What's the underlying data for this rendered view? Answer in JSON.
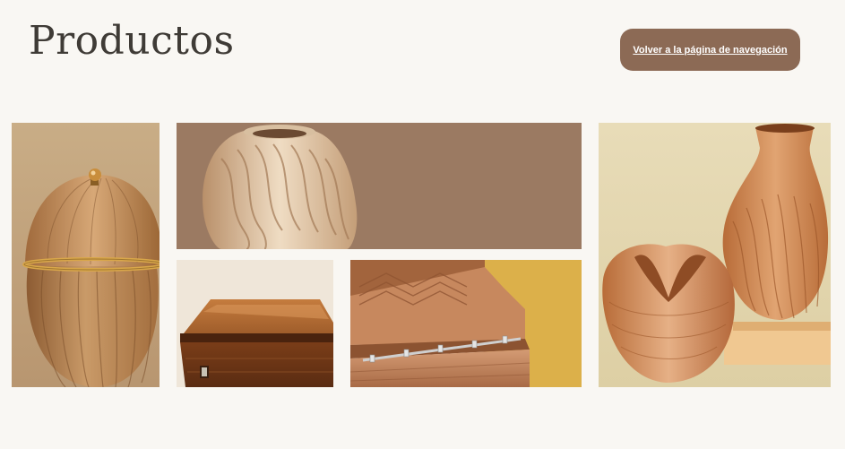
{
  "header": {
    "title": "Productos",
    "nav_button_label": "Volver a la página de navegación"
  },
  "gallery": {
    "items": [
      {
        "name": "wooden-urn-image"
      },
      {
        "name": "carved-vase-image"
      },
      {
        "name": "wooden-coffin-image"
      },
      {
        "name": "carved-casket-image"
      },
      {
        "name": "sculpted-vases-image"
      }
    ]
  },
  "colors": {
    "background": "#f9f7f3",
    "button": "#8c6a55",
    "title": "#3f3b36"
  }
}
